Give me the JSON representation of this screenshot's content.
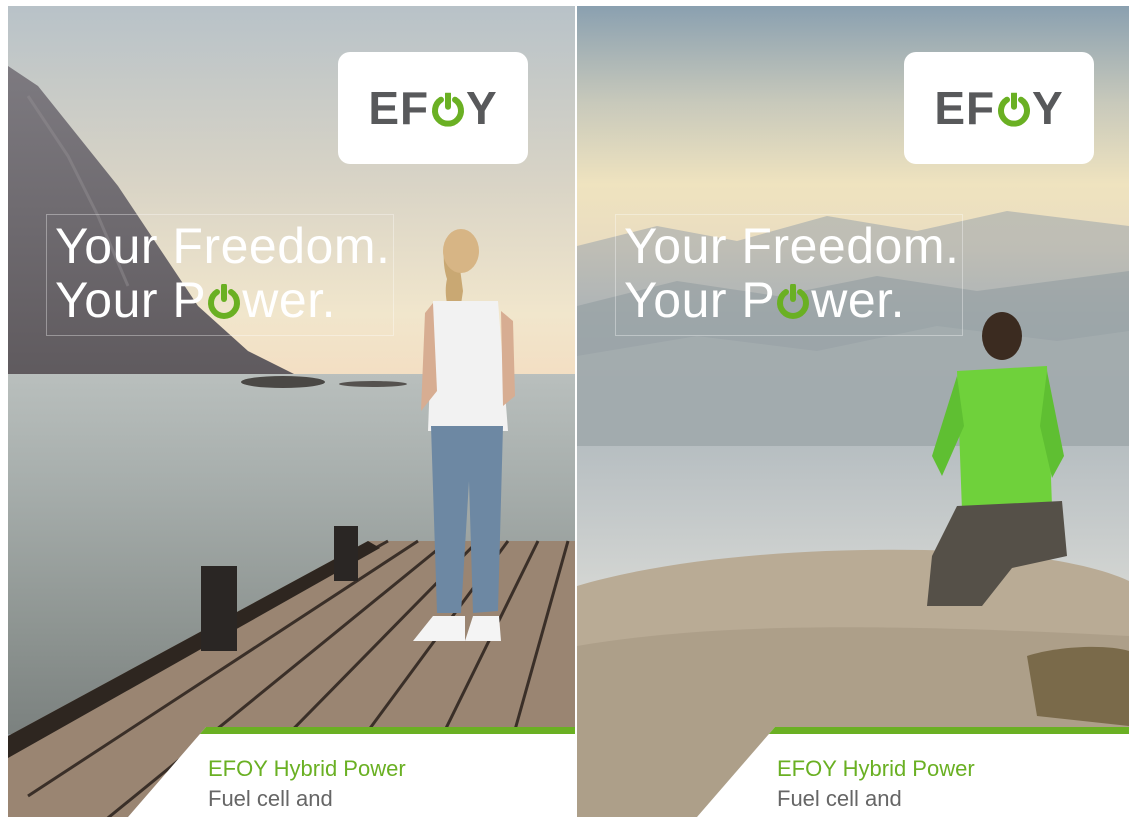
{
  "posters": [
    {
      "logo": "EFOY",
      "headline_line1": "Your Freedom.",
      "headline_line2_prefix": "Your P",
      "headline_line2_suffix": "wer.",
      "footer_title": "EFOY Hybrid Power",
      "footer_subtitle": "Fuel cell and"
    },
    {
      "logo": "EFOY",
      "headline_line1": "Your Freedom.",
      "headline_line2_prefix": "Your P",
      "headline_line2_suffix": "wer.",
      "footer_title": "EFOY Hybrid Power",
      "footer_subtitle": "Fuel cell and"
    }
  ],
  "colors": {
    "brand_green": "#6ab023",
    "logo_gray": "#58595b"
  },
  "icons": {
    "logo_o": "power-icon",
    "headline_o": "power-icon"
  }
}
